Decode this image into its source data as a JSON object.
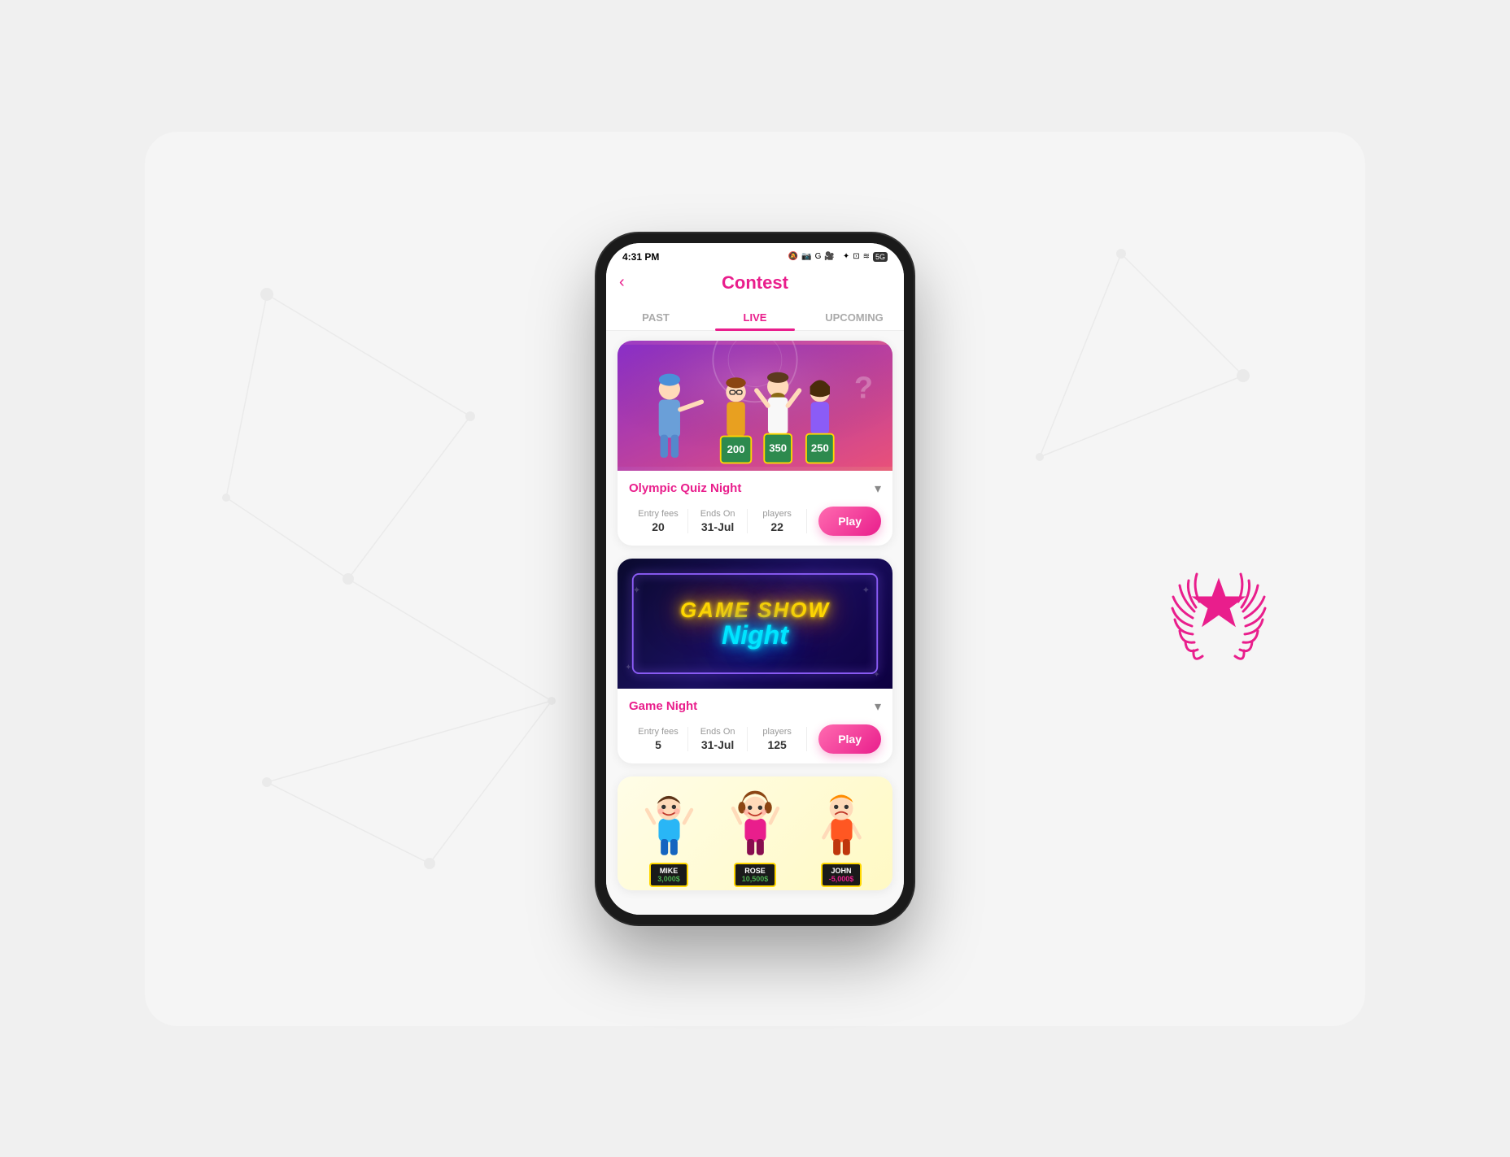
{
  "background": {
    "color": "#f0f0f0"
  },
  "header": {
    "back_label": "‹",
    "title": "Contest"
  },
  "tabs": [
    {
      "id": "past",
      "label": "PAST",
      "active": false
    },
    {
      "id": "live",
      "label": "LIVE",
      "active": true
    },
    {
      "id": "upcoming",
      "label": "UPCOMING",
      "active": false
    }
  ],
  "status_bar": {
    "time": "4:31 PM",
    "icons": "🔕 📷 G 🎥 •  •  •  ✦ ⊡ ≋ 5G"
  },
  "cards": [
    {
      "id": "olympic-quiz",
      "title": "Olympic Quiz Night",
      "banner_type": "quiz",
      "scores": [
        "200",
        "350",
        "250"
      ],
      "entry_fee_label": "Entry fees",
      "entry_fee_value": "20",
      "ends_on_label": "Ends On",
      "ends_on_value": "31-Jul",
      "players_label": "players",
      "players_value": "22",
      "play_label": "Play"
    },
    {
      "id": "game-show",
      "title": "Game Night",
      "banner_type": "gameshow",
      "banner_line1": "GAME SHOW",
      "banner_line2": "Night",
      "entry_fee_label": "Entry fees",
      "entry_fee_value": "5",
      "ends_on_label": "Ends On",
      "ends_on_value": "31-Jul",
      "players_label": "players",
      "players_value": "125",
      "play_label": "Play"
    },
    {
      "id": "kids-contest",
      "banner_type": "kids",
      "kids": [
        {
          "name": "MIKE",
          "score": "3,000$",
          "mood": "happy"
        },
        {
          "name": "ROSE",
          "score": "10,500$",
          "mood": "happy"
        },
        {
          "name": "JOHN",
          "score": "-5,000$",
          "mood": "sad"
        }
      ]
    }
  ],
  "award": {
    "color": "#e91e8c"
  }
}
